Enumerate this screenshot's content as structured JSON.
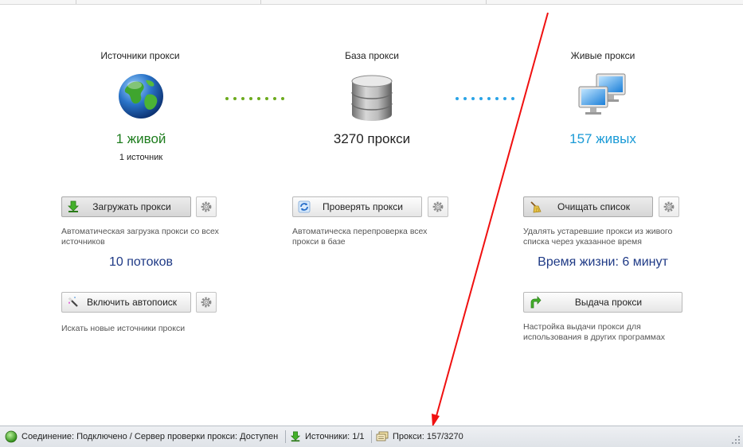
{
  "columns": {
    "sources": {
      "title": "Источники прокси",
      "big_value": "1 живой",
      "small_value": "1 источник",
      "load_button": "Загружать прокси",
      "load_desc": "Автоматическая загрузка прокси со всех источников",
      "threads": "10 потоков",
      "autosearch_button": "Включить автопоиск",
      "autosearch_desc": "Искать новые источники прокси"
    },
    "base": {
      "title": "База прокси",
      "big_value": "3270 прокси",
      "check_button": "Проверять прокси",
      "check_desc": "Автоматическа перепроверка всех прокси в базе"
    },
    "live": {
      "title": "Живые прокси",
      "big_value": "157 живых",
      "clear_button": "Очищать список",
      "clear_desc": "Удалять устаревшие прокси из живого списка через указанное время",
      "lifetime": "Время жизни: 6 минут",
      "issue_button": "Выдача прокси",
      "issue_desc": "Настройка выдачи прокси для использования в других программах"
    }
  },
  "statusbar": {
    "connection": "Соединение: Подключено / Сервер проверки прокси: Доступен",
    "sources": "Источники: 1/1",
    "proxies": "Прокси: 157/3270"
  },
  "colors": {
    "green_value": "#1e7d1e",
    "blue_value": "#1a9ad6",
    "stat_value": "#1f3a86",
    "green_dots": "#6cab1e",
    "blue_dots": "#2aa4e6",
    "annotation_arrow": "#f01010"
  },
  "icons": {
    "sources": "globe-icon",
    "base": "database-icon",
    "live": "monitors-icon",
    "load": "download-arrow-icon",
    "check": "refresh-icon",
    "clear": "broom-icon",
    "autosearch": "magic-wand-icon",
    "issue": "green-arrow-icon",
    "settings": "gear-icon"
  }
}
